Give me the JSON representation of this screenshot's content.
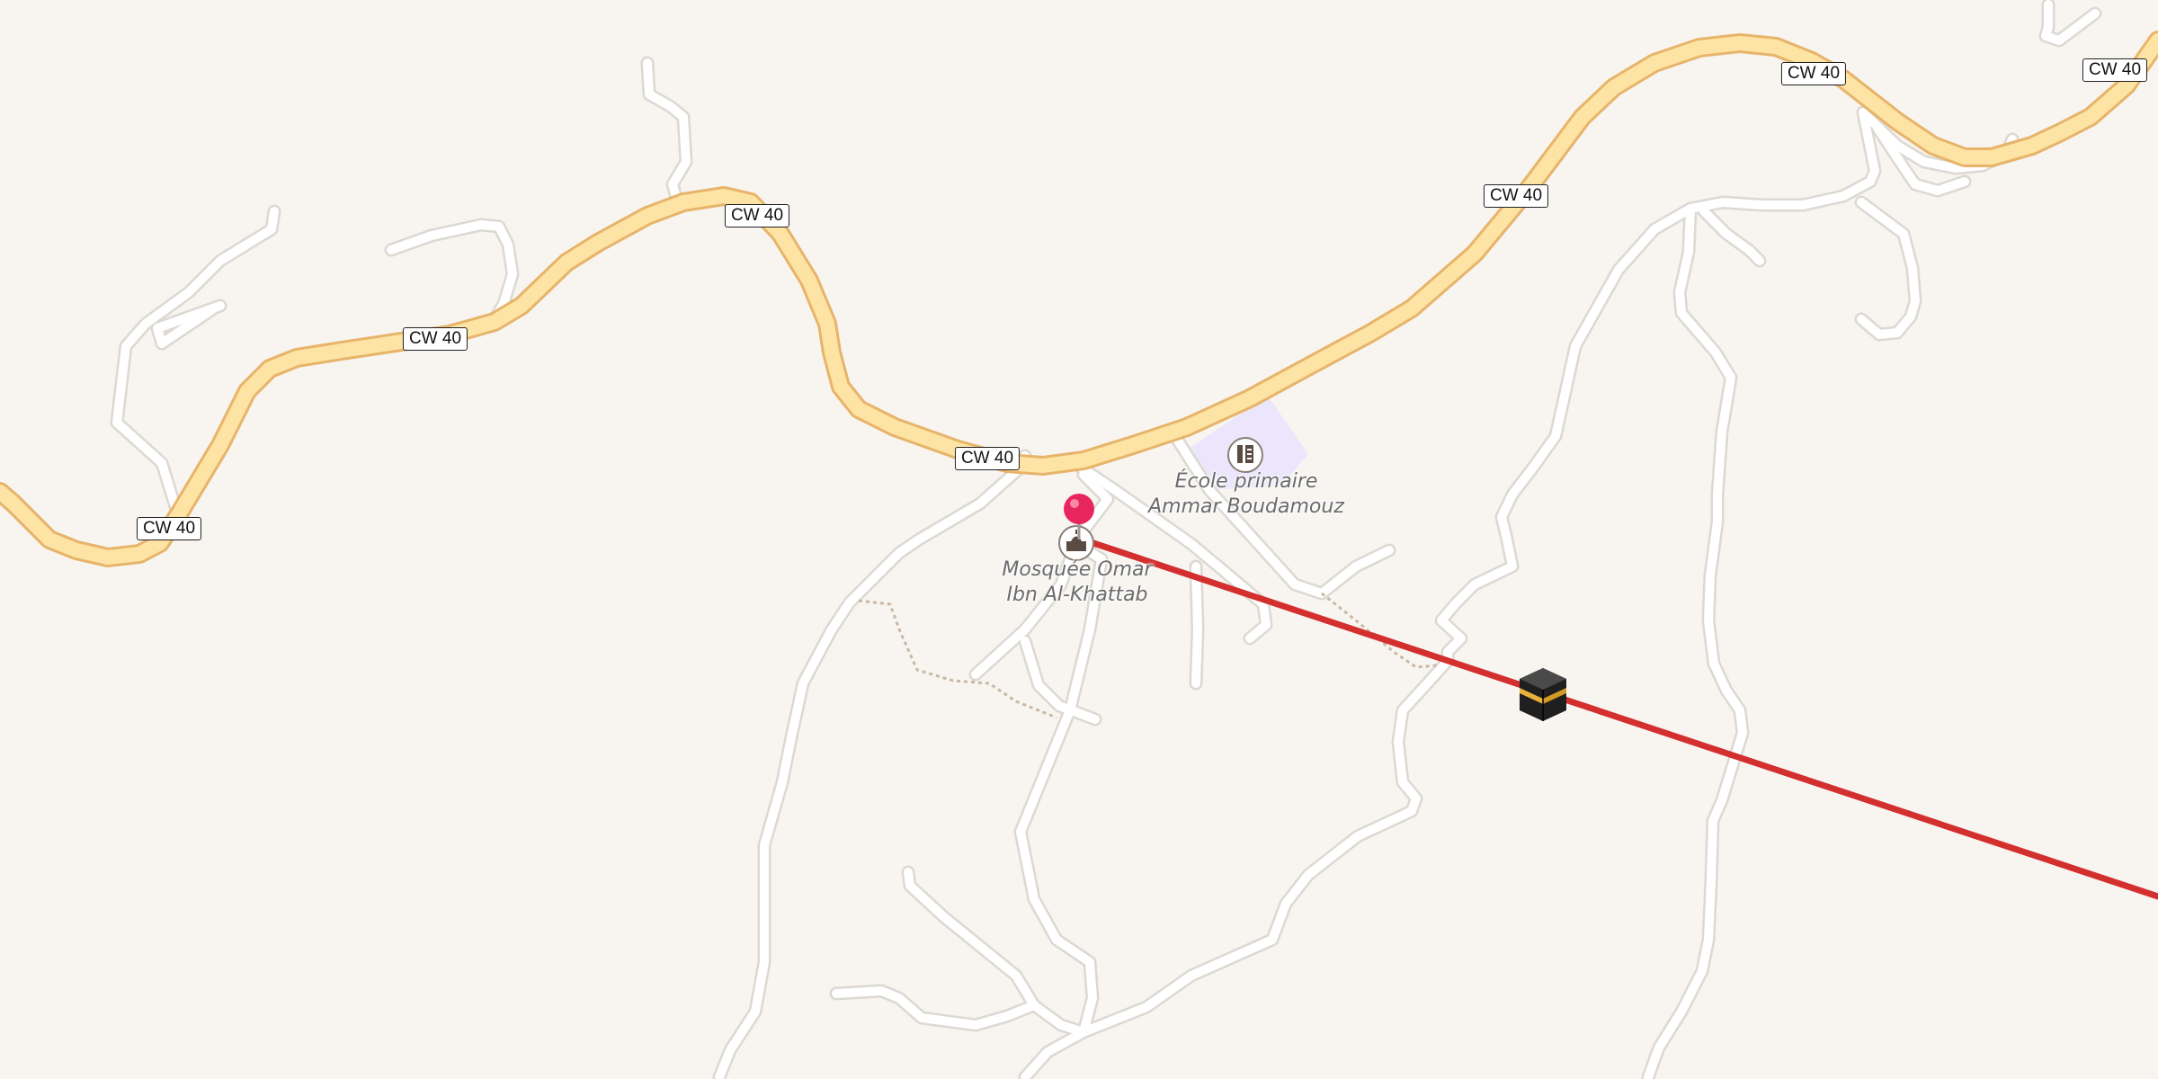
{
  "map": {
    "road_shields": [
      {
        "id": "s1",
        "label": "CW 40"
      },
      {
        "id": "s2",
        "label": "CW 40"
      },
      {
        "id": "s3",
        "label": "CW 40"
      },
      {
        "id": "s4",
        "label": "CW 40"
      },
      {
        "id": "s5",
        "label": "CW 40"
      },
      {
        "id": "s6",
        "label": "CW 40"
      },
      {
        "id": "s7",
        "label": "CW 40"
      }
    ],
    "pois": {
      "school": {
        "line1": "École primaire",
        "line2": "Ammar Boudamouz",
        "icon": "school-icon"
      },
      "mosque": {
        "line1": "Mosquée Omar",
        "line2": "Ibn Al-Khattab",
        "icon": "mosque-icon"
      }
    },
    "markers": {
      "location_pin": "red-pin-icon",
      "qibla": "kaaba-icon"
    },
    "colors": {
      "background": "#f8f5f1",
      "primary_road": "#fde4a4",
      "primary_road_casing": "#e7b46a",
      "minor_road": "#ffffff",
      "minor_road_casing": "#dcd8d2",
      "qibla_line": "#d32f2f",
      "school_area": "#ebe6fb",
      "pin": "#e8265e"
    }
  }
}
